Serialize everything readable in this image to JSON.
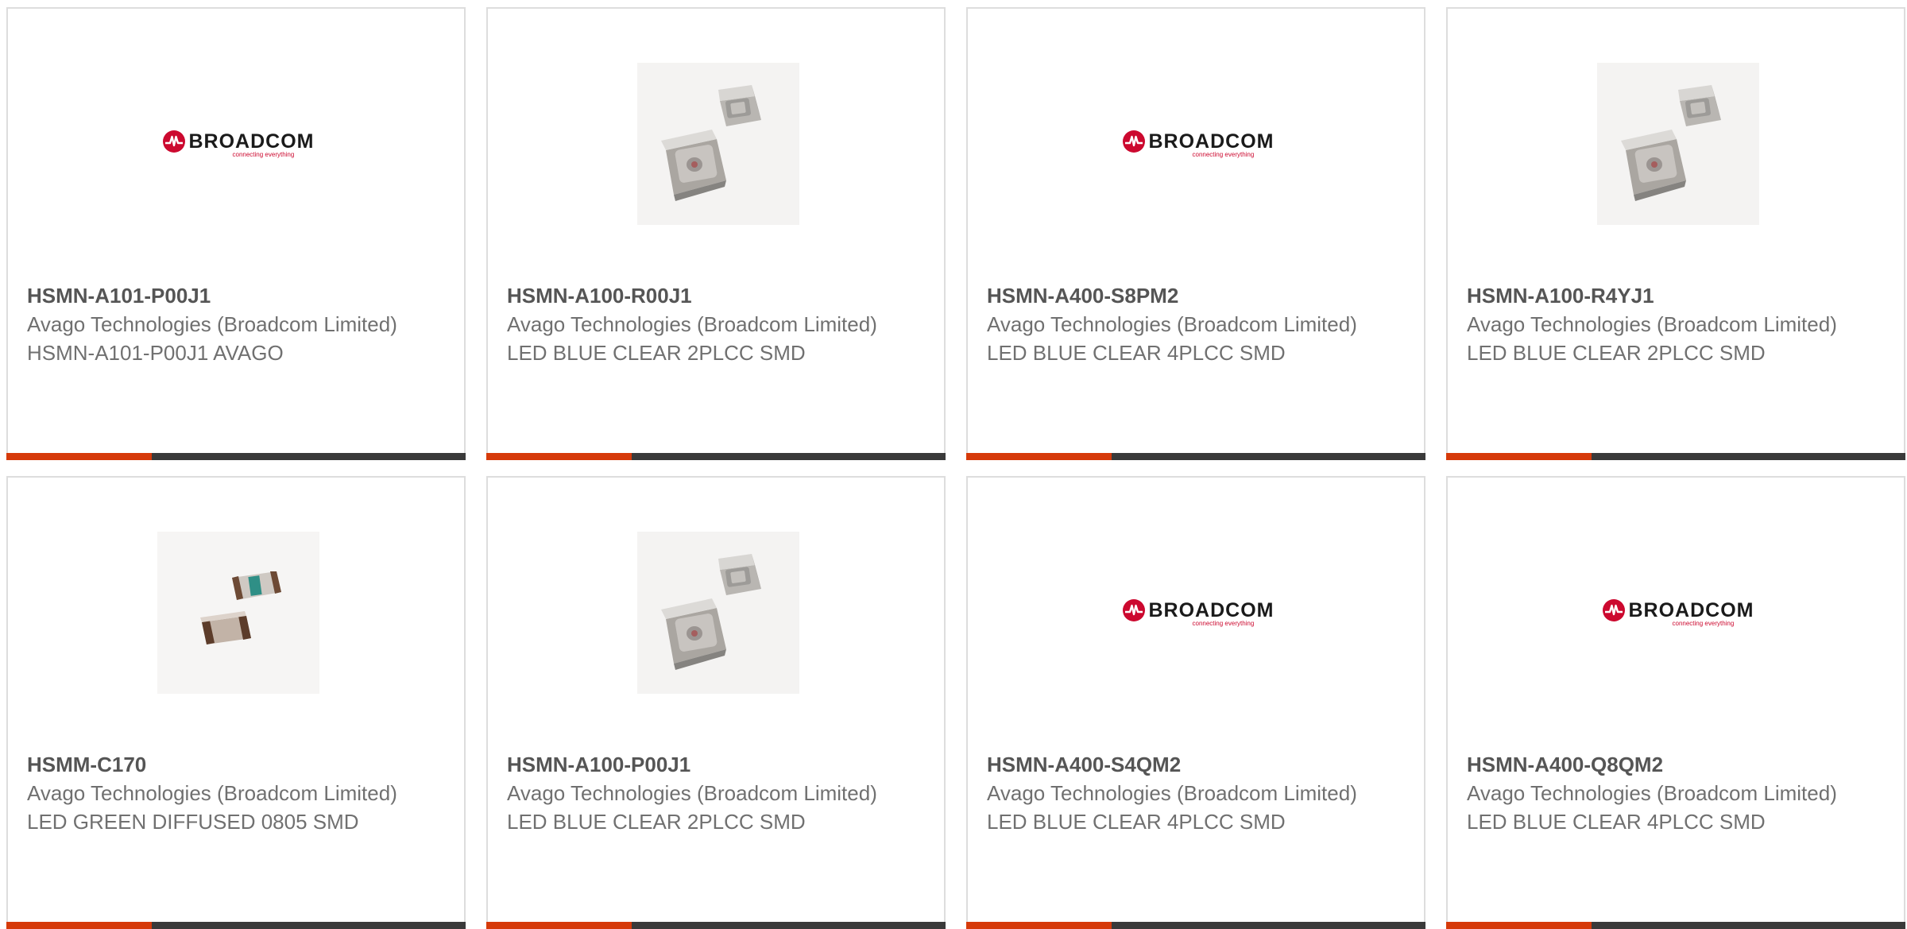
{
  "products": [
    {
      "part_number": "HSMN-A101-P00J1",
      "manufacturer": "Avago Technologies (Broadcom Limited)",
      "description": "HSMN-A101-P00J1 AVAGO",
      "image": "broadcom-logo"
    },
    {
      "part_number": "HSMN-A100-R00J1",
      "manufacturer": "Avago Technologies (Broadcom Limited)",
      "description": "LED BLUE CLEAR 2PLCC SMD",
      "image": "plcc-led-photo"
    },
    {
      "part_number": "HSMN-A400-S8PM2",
      "manufacturer": "Avago Technologies (Broadcom Limited)",
      "description": "LED BLUE CLEAR 4PLCC SMD",
      "image": "broadcom-logo"
    },
    {
      "part_number": "HSMN-A100-R4YJ1",
      "manufacturer": "Avago Technologies (Broadcom Limited)",
      "description": "LED BLUE CLEAR 2PLCC SMD",
      "image": "plcc-led-photo"
    },
    {
      "part_number": "HSMM-C170",
      "manufacturer": "Avago Technologies (Broadcom Limited)",
      "description": "LED GREEN DIFFUSED 0805 SMD",
      "image": "chip-led-photo"
    },
    {
      "part_number": "HSMN-A100-P00J1",
      "manufacturer": "Avago Technologies (Broadcom Limited)",
      "description": "LED BLUE CLEAR 2PLCC SMD",
      "image": "plcc-led-photo"
    },
    {
      "part_number": "HSMN-A400-S4QM2",
      "manufacturer": "Avago Technologies (Broadcom Limited)",
      "description": "LED BLUE CLEAR 4PLCC SMD",
      "image": "broadcom-logo"
    },
    {
      "part_number": "HSMN-A400-Q8QM2",
      "manufacturer": "Avago Technologies (Broadcom Limited)",
      "description": "LED BLUE CLEAR 4PLCC SMD",
      "image": "broadcom-logo"
    }
  ],
  "logo": {
    "wordmark": "BROADCOM",
    "tagline": "connecting everything"
  },
  "colors": {
    "accent": "#d63a0a",
    "bar": "#3a3a3a",
    "border": "#dddddd",
    "logo_red": "#cc092f"
  }
}
